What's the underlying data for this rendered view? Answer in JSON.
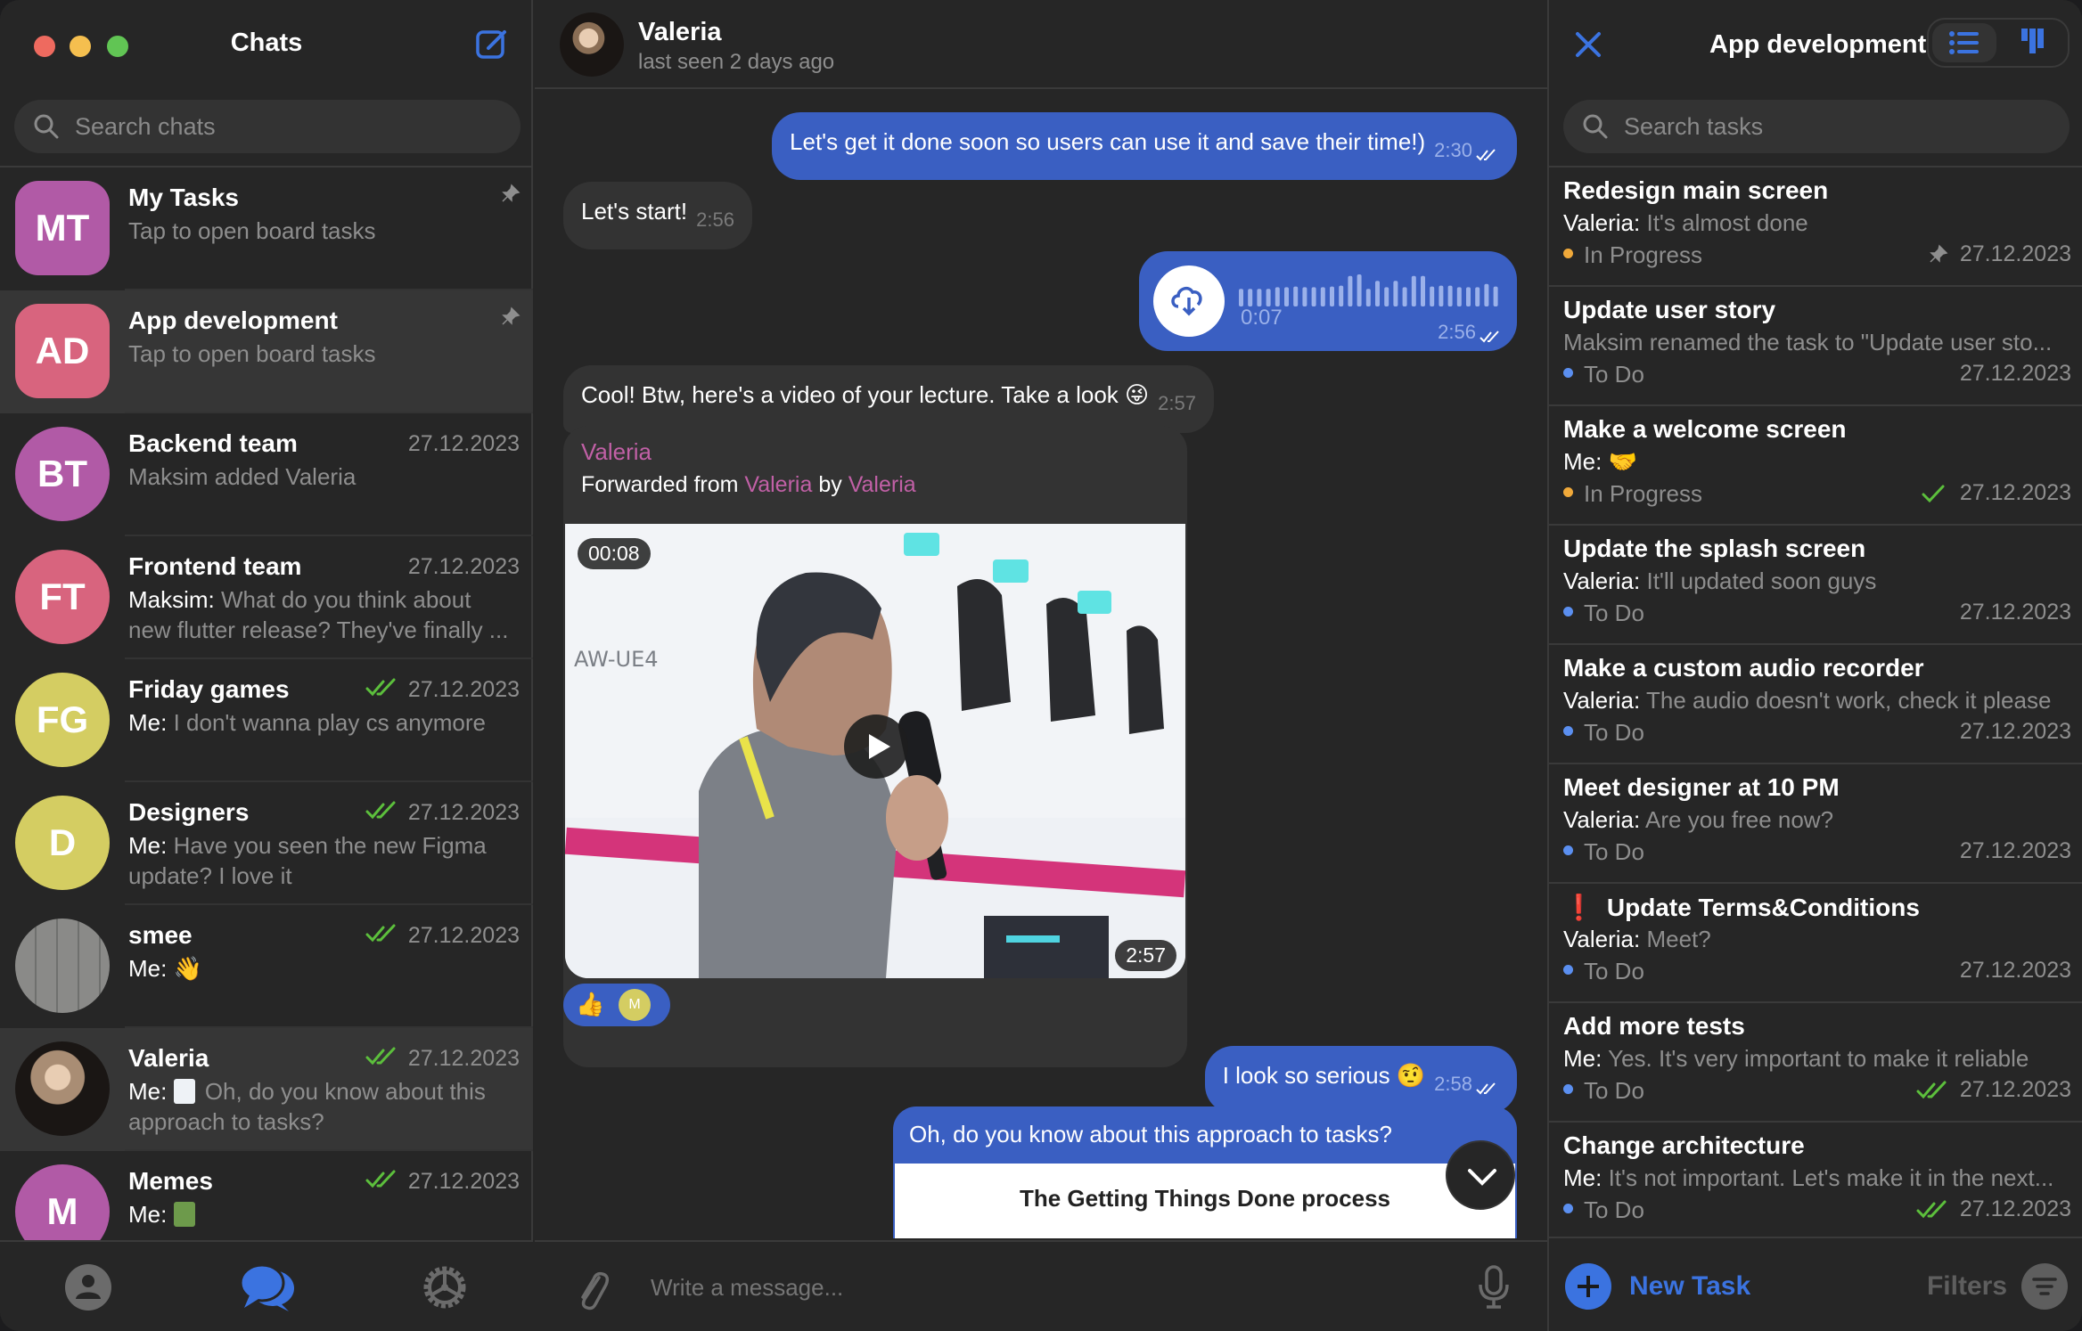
{
  "colors": {
    "accent": "#3b73e0",
    "outgoing_bubble": "#3a5fc2",
    "incoming_bubble": "#333333",
    "read_check": "#5cbf3c",
    "status_in_progress": "#f0a93a",
    "status_todo": "#5b8ff0",
    "forward_name": "#c160a6",
    "urgent": "#e0342f"
  },
  "sidebar": {
    "title": "Chats",
    "search_placeholder": "Search chats",
    "chats": [
      {
        "initials": "MT",
        "name": "My Tasks",
        "preview": "Tap to open board tasks",
        "pinned": true,
        "color": "#b15aa6",
        "shape": "square"
      },
      {
        "initials": "AD",
        "name": "App development",
        "preview": "Tap to open board tasks",
        "pinned": true,
        "active": true,
        "color": "#d8647e",
        "shape": "square"
      },
      {
        "initials": "BT",
        "name": "Backend team",
        "preview": "Maksim added Valeria",
        "date": "27.12.2023",
        "color": "#b15aa6"
      },
      {
        "initials": "FT",
        "name": "Frontend team",
        "sender": "Maksim:",
        "preview": "What do you think about new flutter release? They've finally ...",
        "date": "27.12.2023",
        "color": "#d8647e"
      },
      {
        "initials": "FG",
        "name": "Friday games",
        "sender": "Me:",
        "preview": "I don't wanna play cs anymore",
        "date": "27.12.2023",
        "read": true,
        "color": "#d4cd62"
      },
      {
        "initials": "D",
        "name": "Designers",
        "sender": "Me:",
        "preview": "Have you seen the new Figma update?   I love it",
        "date": "27.12.2023",
        "read": true,
        "color": "#d4cd62"
      },
      {
        "initials": "",
        "name": "smee",
        "sender": "Me:",
        "preview": "👋",
        "date": "27.12.2023",
        "read": true,
        "color": "#8a8a88"
      },
      {
        "initials": "",
        "name": "Valeria",
        "sender": "Me:",
        "preview": "Oh, do you know about this approach to tasks?",
        "date": "27.12.2023",
        "read": true,
        "active": true,
        "color": "#2a2320"
      },
      {
        "initials": "M",
        "name": "Memes",
        "sender": "Me:",
        "preview": "",
        "date": "27.12.2023",
        "read": true,
        "color": "#b15aa6"
      }
    ],
    "bottom_tabs": [
      "contacts",
      "chats",
      "settings"
    ],
    "active_tab": "chats"
  },
  "chat": {
    "name": "Valeria",
    "status": "last seen 2 days ago",
    "messages": [
      {
        "dir": "out",
        "text": "Let's get it done soon so users can use it and save their time!)",
        "time": "2:30",
        "read": true
      },
      {
        "dir": "in",
        "text": "Let's start!",
        "time": "2:56"
      },
      {
        "dir": "out",
        "type": "voice",
        "duration": "0:07",
        "time": "2:56",
        "read": true
      },
      {
        "dir": "in",
        "text": "Cool! Btw, here's a video of your lecture. Take a look 😜",
        "time": "2:57"
      },
      {
        "dir": "in",
        "type": "video",
        "sender": "Valeria",
        "forwarded_prefix": "Forwarded from",
        "forwarded_from": "Valeria",
        "by_word": "by",
        "forwarded_by": "Valeria",
        "video_elapsed": "00:08",
        "time": "2:57",
        "reaction": "👍",
        "reaction_user": "M"
      },
      {
        "dir": "out",
        "text": "I look so serious 🤨",
        "time": "2:58",
        "read": true
      },
      {
        "dir": "out",
        "type": "link",
        "text": "Oh, do you know about this approach to tasks?",
        "card_title": "The Getting Things Done process"
      }
    ],
    "composer_placeholder": "Write a message..."
  },
  "tasks": {
    "title": "App development",
    "view_modes": [
      "list",
      "board"
    ],
    "active_view": "list",
    "search_placeholder": "Search tasks",
    "items": [
      {
        "title": "Redesign main screen",
        "sender": "Valeria:",
        "preview": "It's almost done",
        "status": "In Progress",
        "date": "27.12.2023",
        "mark": "pin"
      },
      {
        "title": "Update user story",
        "sender": "",
        "preview": "Maksim renamed the task to \"Update user sto...",
        "status": "To Do",
        "date": "27.12.2023",
        "mark": ""
      },
      {
        "title": "Make a welcome screen",
        "sender": "Me:",
        "preview": "🤝",
        "status": "In Progress",
        "date": "27.12.2023",
        "mark": "check"
      },
      {
        "title": "Update the splash screen",
        "sender": "Valeria:",
        "preview": "It'll updated soon guys",
        "status": "To Do",
        "date": "27.12.2023",
        "mark": ""
      },
      {
        "title": "Make a custom audio recorder",
        "sender": "Valeria:",
        "preview": "The audio doesn't work, check it please",
        "status": "To Do",
        "date": "27.12.2023",
        "mark": ""
      },
      {
        "title": "Meet designer at 10 PM",
        "sender": "Valeria:",
        "preview": "Are you free now?",
        "status": "To Do",
        "date": "27.12.2023",
        "mark": ""
      },
      {
        "title": "Update Terms&Conditions",
        "urgent": true,
        "urgent_glyph": "❗",
        "sender": "Valeria:",
        "preview": "Meet?",
        "status": "To Do",
        "date": "27.12.2023",
        "mark": ""
      },
      {
        "title": "Add more tests",
        "sender": "Me:",
        "preview": "Yes. It's very important to make it reliable",
        "status": "To Do",
        "date": "27.12.2023",
        "mark": "double-check"
      },
      {
        "title": "Change architecture",
        "sender": "Me:",
        "preview": "It's not important. Let's make it in the next...",
        "status": "To Do",
        "date": "27.12.2023",
        "mark": "double-check"
      }
    ],
    "new_task_label": "New Task",
    "filters_label": "Filters"
  }
}
